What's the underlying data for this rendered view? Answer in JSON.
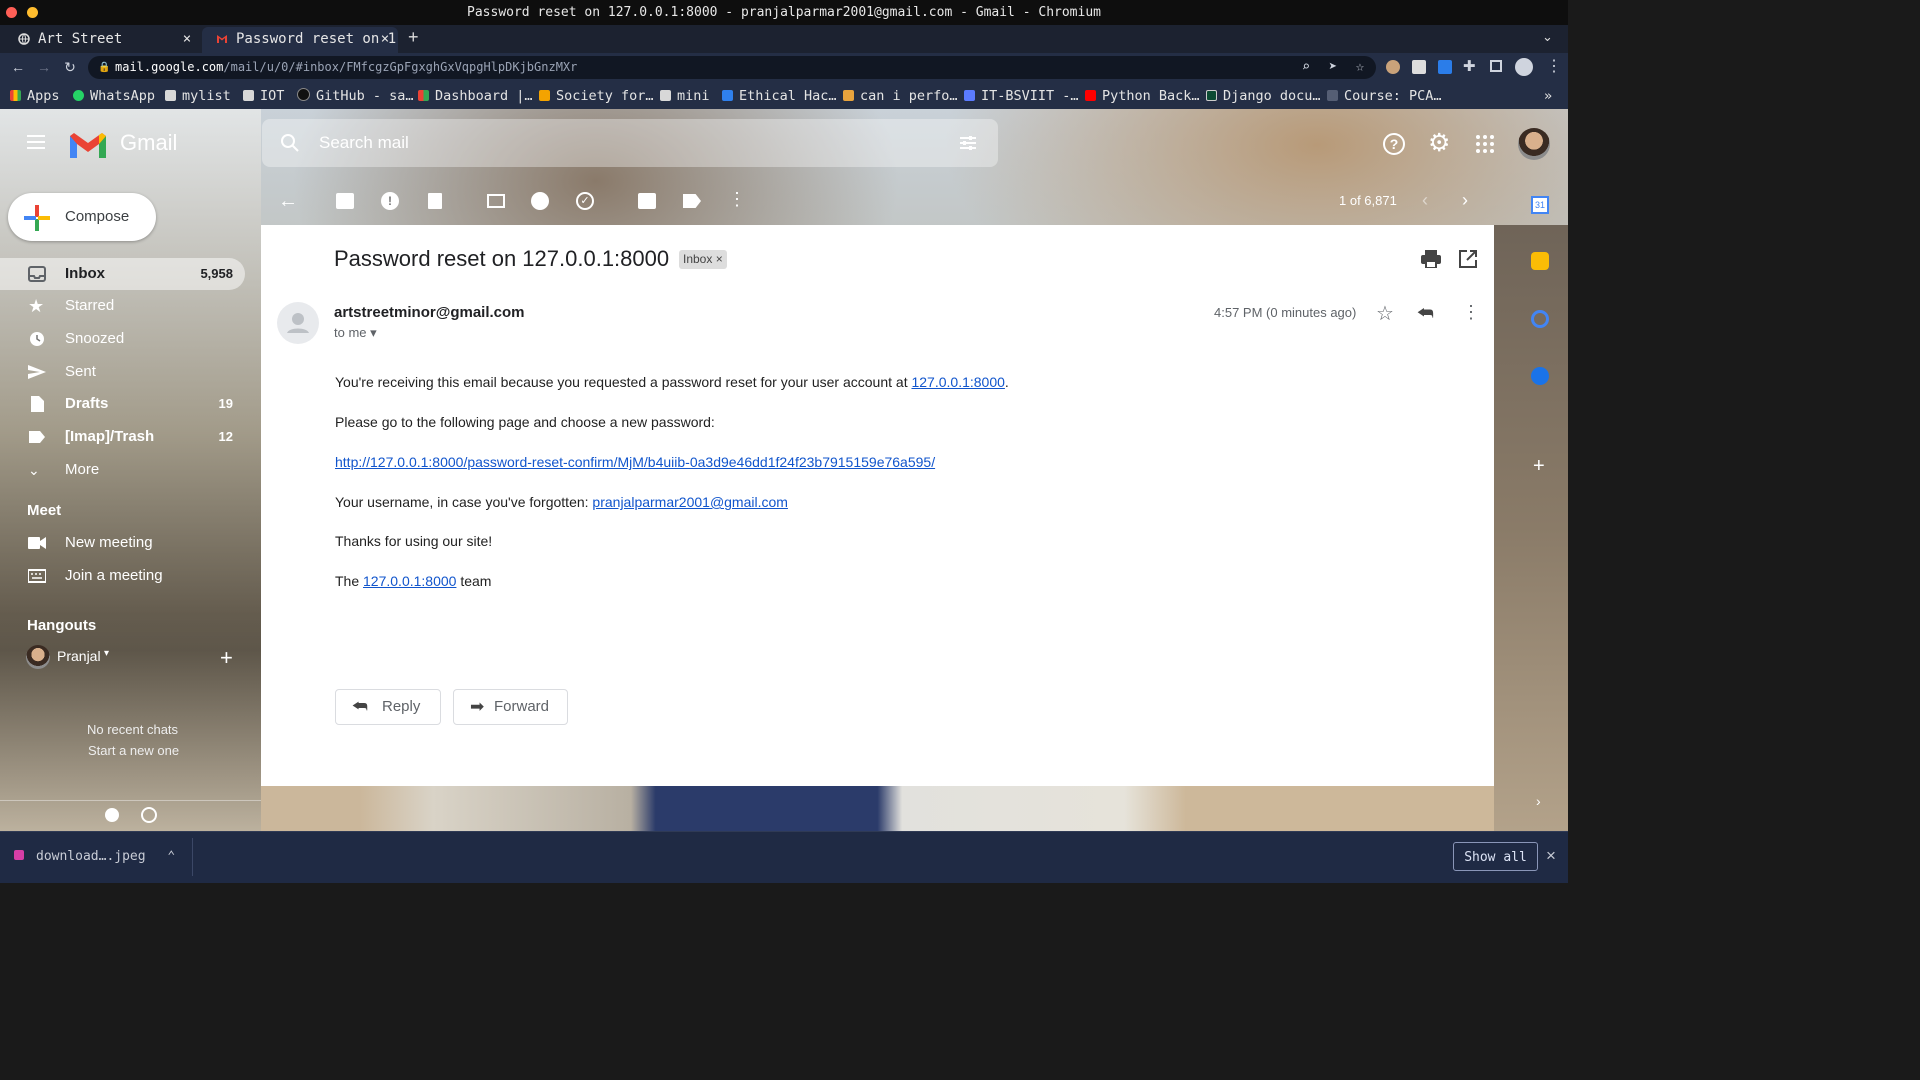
{
  "window": {
    "title": "Password reset on 127.0.0.1:8000 - pranjalparmar2001@gmail.com - Gmail - Chromium"
  },
  "tabs": [
    {
      "label": "Art Street",
      "close": "×"
    },
    {
      "label": "Password reset on 1",
      "close": "×"
    }
  ],
  "new_tab": "+",
  "address": {
    "host": "mail.google.com",
    "path": "/mail/u/0/#inbox/FMfcgzGpFgxghGxVqpgHlpDKjbGnzMXr"
  },
  "bookmarks": [
    "Apps",
    "WhatsApp",
    "mylist",
    "IOT",
    "GitHub - sa…",
    "Dashboard |…",
    "Society for…",
    "mini",
    "Ethical Hac…",
    "can i perfo…",
    "IT-BSVIIT -…",
    "Python Back…",
    "Django docu…",
    "Course: PCA…"
  ],
  "bookmarks_more": "»",
  "gmail": {
    "logo_text": "Gmail",
    "search_placeholder": "Search mail",
    "compose": "Compose",
    "nav": [
      {
        "label": "Inbox",
        "count": "5,958"
      },
      {
        "label": "Starred",
        "count": ""
      },
      {
        "label": "Snoozed",
        "count": ""
      },
      {
        "label": "Sent",
        "count": ""
      },
      {
        "label": "Drafts",
        "count": "19"
      },
      {
        "label": "[Imap]/Trash",
        "count": "12"
      },
      {
        "label": "More",
        "count": ""
      }
    ],
    "meet": {
      "heading": "Meet",
      "new_meeting": "New meeting",
      "join": "Join a meeting"
    },
    "hangouts": {
      "heading": "Hangouts",
      "user": "Pranjal",
      "no_chats": "No recent chats",
      "start_new": "Start a new one"
    },
    "pager": "1 of 6,871"
  },
  "email": {
    "subject": "Password reset on 127.0.0.1:8000",
    "label": "Inbox",
    "label_close": "×",
    "from": "artstreetminor@gmail.com",
    "to": "to me",
    "time": "4:57 PM (0 minutes ago)",
    "body": {
      "line1_pre": "You're receiving this email because you requested a password reset for your user account at ",
      "line1_link": "127.0.0.1:8000",
      "line1_post": ".",
      "line2": "Please go to the following page and choose a new password:",
      "reset_link": "http://127.0.0.1:8000/password-reset-confirm/MjM/b4uiib-0a3d9e46dd1f24f23b7915159e76a595/",
      "line3_pre": "Your username, in case you've forgotten: ",
      "line3_link": "pranjalparmar2001@gmail.com",
      "line4": "Thanks for using our site!",
      "sign_pre": "The ",
      "sign_link": "127.0.0.1:8000",
      "sign_post": " team"
    },
    "reply": "Reply",
    "forward": "Forward"
  },
  "download": {
    "filename": "download….jpeg",
    "show_all": "Show all",
    "close": "×"
  },
  "colors": {
    "gmail_red": "#ea4335",
    "link": "#1155cc",
    "chrome_dark": "#242e45"
  }
}
